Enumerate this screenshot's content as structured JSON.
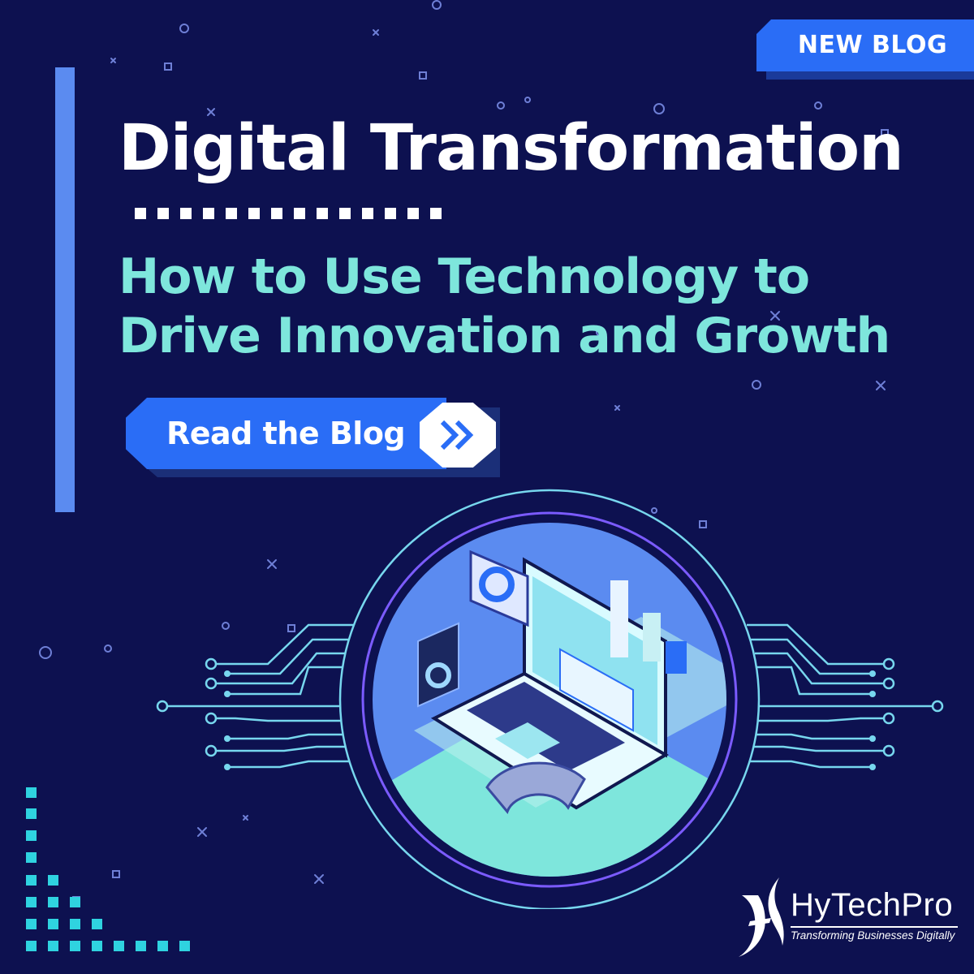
{
  "badge": {
    "label": "NEW BLOG"
  },
  "headline": {
    "title": "Digital Transformation"
  },
  "subheadline": {
    "line1": "How to Use Technology to",
    "line2": "Drive Innovation and Growth"
  },
  "cta": {
    "label": "Read the Blog",
    "icon": "double-chevron-right-icon"
  },
  "brand": {
    "name": "HyTechPro",
    "tagline": "Transforming Businesses Digitally"
  },
  "colors": {
    "background": "#0d1150",
    "accent_blue": "#2a6df6",
    "accent_teal": "#7ee6dc",
    "text_white": "#ffffff"
  }
}
